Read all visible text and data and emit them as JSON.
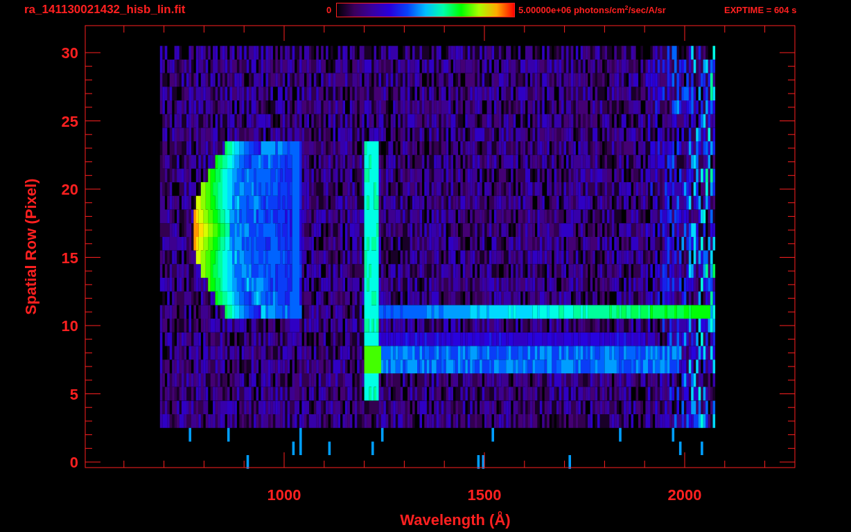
{
  "header": {
    "filename": "ra_141130021432_hisb_lin.fit",
    "colorbar_min": "0",
    "colorbar_max": "5.00000e+06 photons/cm$^{2}$/sec/A/sr",
    "exposure": "EXPTIME = 604 s"
  },
  "plot": {
    "ylabel": "Spatial Row (Pixel)",
    "xlabel": "Wavelength (Å)",
    "xtick_labels": [
      "1000",
      "1500",
      "2000"
    ],
    "ytick_labels": [
      "30",
      "25",
      "20",
      "15",
      "10",
      "5",
      "0"
    ]
  }
}
